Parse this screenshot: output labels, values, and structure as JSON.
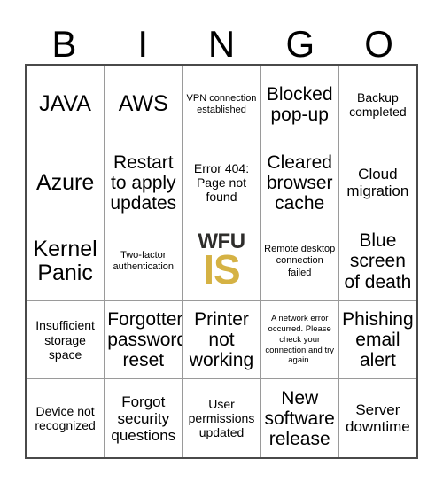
{
  "header": {
    "letters": [
      "B",
      "I",
      "N",
      "G",
      "O"
    ]
  },
  "grid": {
    "rows": 5,
    "columns": 5,
    "cells": [
      {
        "text": "JAVA",
        "size": "fs-xl"
      },
      {
        "text": "AWS",
        "size": "fs-xl"
      },
      {
        "text": "VPN connection established",
        "size": "fs-xs"
      },
      {
        "text": "Blocked pop-up",
        "size": "fs-lg"
      },
      {
        "text": "Backup completed",
        "size": "fs-sm"
      },
      {
        "text": "Azure",
        "size": "fs-xl"
      },
      {
        "text": "Restart to apply updates",
        "size": "fs-lg"
      },
      {
        "text": "Error 404: Page not found",
        "size": "fs-sm"
      },
      {
        "text": "Cleared browser cache",
        "size": "fs-lg"
      },
      {
        "text": "Cloud migration",
        "size": "fs-md"
      },
      {
        "text": "Kernel Panic",
        "size": "fs-xl"
      },
      {
        "text": "Two-factor authentication",
        "size": "fs-xs"
      },
      {
        "text": "",
        "size": "logo"
      },
      {
        "text": "Remote desktop connection failed",
        "size": "fs-xs"
      },
      {
        "text": "Blue screen of death",
        "size": "fs-lg"
      },
      {
        "text": "Insufficient storage space",
        "size": "fs-sm"
      },
      {
        "text": "Forgotten password reset",
        "size": "fs-lg"
      },
      {
        "text": "Printer not working",
        "size": "fs-lg"
      },
      {
        "text": "A network error occurred. Please check your connection and try again.",
        "size": "fs-xxs"
      },
      {
        "text": "Phishing email alert",
        "size": "fs-lg"
      },
      {
        "text": "Device not recognized",
        "size": "fs-sm"
      },
      {
        "text": "Forgot security questions",
        "size": "fs-md"
      },
      {
        "text": "User permissions updated",
        "size": "fs-sm"
      },
      {
        "text": "New software release",
        "size": "fs-lg"
      },
      {
        "text": "Server downtime",
        "size": "fs-md"
      }
    ]
  },
  "logo": {
    "top_text": "WFU",
    "bottom_text": "IS",
    "top_color": "#2e2d2b",
    "bottom_color": "#d5b244"
  },
  "colors": {
    "background": "#ffffff",
    "text": "#000000",
    "grid_line": "#9a9a9a",
    "grid_border": "#4a4a4a",
    "accent_gold": "#d5b244"
  }
}
